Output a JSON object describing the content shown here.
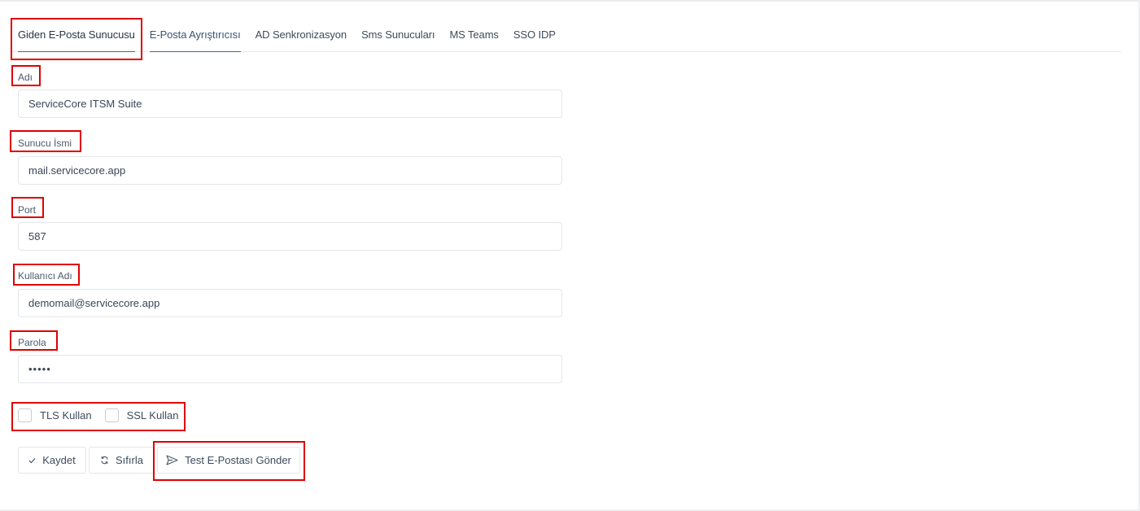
{
  "tabs": [
    {
      "label": "Giden E-Posta Sunucusu",
      "active": true
    },
    {
      "label": "E-Posta Ayrıştırıcısı"
    },
    {
      "label": "AD Senkronizasyon"
    },
    {
      "label": "Sms Sunucuları"
    },
    {
      "label": "MS Teams"
    },
    {
      "label": "SSO IDP"
    }
  ],
  "form": {
    "name": {
      "label": "Adı",
      "value": "ServiceCore ITSM Suite"
    },
    "server": {
      "label": "Sunucu İsmi",
      "value": "mail.servicecore.app"
    },
    "port": {
      "label": "Port",
      "value": "587"
    },
    "username": {
      "label": "Kullanıcı Adı",
      "value": "demomail@servicecore.app"
    },
    "password": {
      "label": "Parola",
      "value": "•••••"
    },
    "tls": {
      "label": "TLS Kullan",
      "checked": false
    },
    "ssl": {
      "label": "SSL Kullan",
      "checked": false
    }
  },
  "actions": {
    "save_label": "Kaydet",
    "reset_label": "Sıfırla",
    "test_label": "Test E-Postası Gönder"
  },
  "icons": {
    "save": "check-icon",
    "reset": "refresh-icon",
    "test": "send-icon"
  },
  "colors": {
    "highlight": "#e00000",
    "tab_underline": "#3c6d96"
  }
}
